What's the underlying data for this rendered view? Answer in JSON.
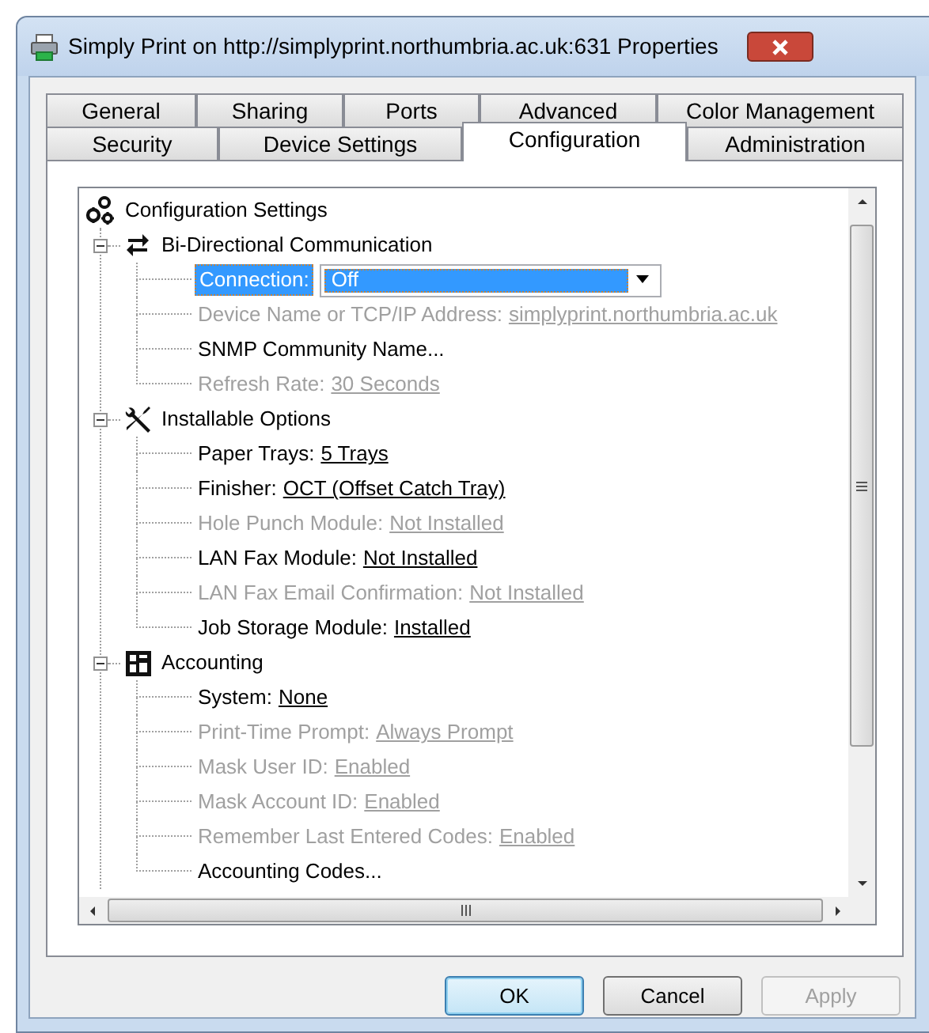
{
  "window": {
    "title": "Simply Print on http://simplyprint.northumbria.ac.uk:631 Properties"
  },
  "tab_rows": [
    {
      "tabs": [
        {
          "label": "General",
          "selected": false
        },
        {
          "label": "Sharing",
          "selected": false
        },
        {
          "label": "Ports",
          "selected": false
        },
        {
          "label": "Advanced",
          "selected": false
        },
        {
          "label": "Color Management",
          "selected": false
        }
      ]
    },
    {
      "tabs": [
        {
          "label": "Security",
          "selected": false
        },
        {
          "label": "Device Settings",
          "selected": false
        },
        {
          "label": "Configuration",
          "selected": true
        },
        {
          "label": "Administration",
          "selected": false
        }
      ]
    }
  ],
  "tree": {
    "label": "Configuration Settings",
    "groups": [
      {
        "label": "Bi-Directional Communication",
        "kind": "communication",
        "expanded": true,
        "children": [
          {
            "kind": "dropdown",
            "label": "Connection:",
            "value": "Off",
            "disabled": false,
            "selected": true
          },
          {
            "kind": "setting",
            "label": "Device Name or TCP/IP Address:",
            "value": "simplyprint.northumbria.ac.uk",
            "disabled": true,
            "selected": false
          },
          {
            "kind": "action",
            "label": "SNMP Community Name...",
            "disabled": false,
            "selected": false
          },
          {
            "kind": "setting",
            "label": "Refresh Rate:",
            "value": "30 Seconds",
            "disabled": true,
            "selected": false
          }
        ]
      },
      {
        "label": "Installable Options",
        "kind": "tools",
        "expanded": true,
        "children": [
          {
            "kind": "setting",
            "label": "Paper Trays:",
            "value": "5 Trays",
            "disabled": false,
            "selected": false
          },
          {
            "kind": "setting",
            "label": "Finisher:",
            "value": "OCT (Offset Catch Tray)",
            "disabled": false,
            "selected": false
          },
          {
            "kind": "setting",
            "label": "Hole Punch Module:",
            "value": "Not Installed",
            "disabled": true,
            "selected": false
          },
          {
            "kind": "setting",
            "label": "LAN Fax Module:",
            "value": "Not Installed",
            "disabled": false,
            "selected": false
          },
          {
            "kind": "setting",
            "label": "LAN Fax Email Confirmation:",
            "value": "Not Installed",
            "disabled": true,
            "selected": false
          },
          {
            "kind": "setting",
            "label": "Job Storage Module:",
            "value": "Installed",
            "disabled": false,
            "selected": false
          }
        ]
      },
      {
        "label": "Accounting",
        "kind": "accounting",
        "expanded": true,
        "children": [
          {
            "kind": "setting",
            "label": "System:",
            "value": "None",
            "disabled": false,
            "selected": false
          },
          {
            "kind": "setting",
            "label": "Print-Time Prompt:",
            "value": "Always Prompt",
            "disabled": true,
            "selected": false
          },
          {
            "kind": "setting",
            "label": "Mask User ID:",
            "value": "Enabled",
            "disabled": true,
            "selected": false
          },
          {
            "kind": "setting",
            "label": "Mask Account ID:",
            "value": "Enabled",
            "disabled": true,
            "selected": false
          },
          {
            "kind": "setting",
            "label": "Remember Last Entered Codes:",
            "value": "Enabled",
            "disabled": true,
            "selected": false
          },
          {
            "kind": "action",
            "label": "Accounting Codes...",
            "disabled": false,
            "selected": false
          }
        ]
      }
    ]
  },
  "buttons": [
    {
      "label": "OK",
      "kind": "default",
      "disabled": false
    },
    {
      "label": "Cancel",
      "kind": "normal",
      "disabled": false
    },
    {
      "label": "Apply",
      "kind": "normal",
      "disabled": true
    }
  ]
}
